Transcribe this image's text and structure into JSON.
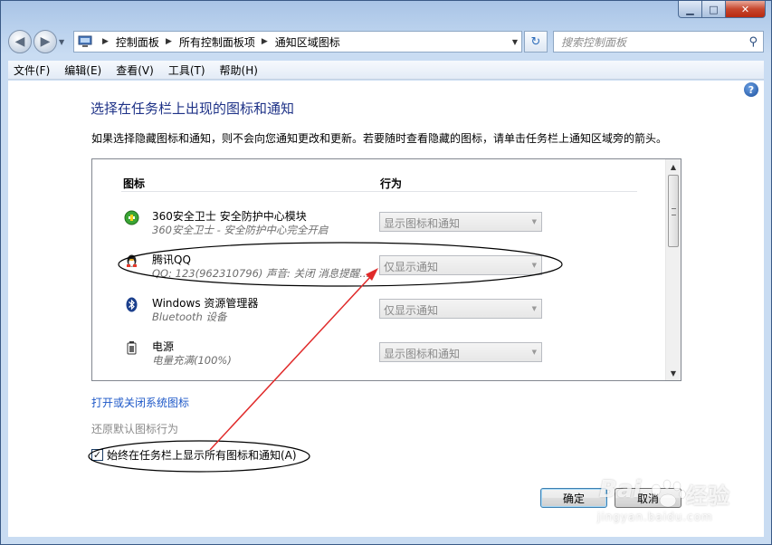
{
  "window": {
    "caption_buttons": {
      "minimize": "▁",
      "maximize": "□",
      "close": "✕"
    }
  },
  "nav": {
    "back_icon": "◀",
    "forward_icon": "▶",
    "breadcrumb": [
      "控制面板",
      "所有控制面板项",
      "通知区域图标"
    ],
    "search_placeholder": "搜索控制面板"
  },
  "menu": [
    "文件(F)",
    "编辑(E)",
    "查看(V)",
    "工具(T)",
    "帮助(H)"
  ],
  "page": {
    "title": "选择在任务栏上出现的图标和通知",
    "description": "如果选择隐藏图标和通知，则不会向您通知更改和更新。若要随时查看隐藏的图标，请单击任务栏上通知区域旁的箭头。",
    "col_icon": "图标",
    "col_behavior": "行为",
    "rows": [
      {
        "name": "360安全卫士 安全防护中心模块",
        "sub": "360安全卫士 - 安全防护中心完全开启",
        "behavior": "显示图标和通知",
        "icon": "shield-icon"
      },
      {
        "name": "腾讯QQ",
        "sub": "QQ: 123(962310796)  声音: 关闭  消息提醒...",
        "behavior": "仅显示通知",
        "icon": "qq-penguin-icon"
      },
      {
        "name": "Windows 资源管理器",
        "sub": "Bluetooth 设备",
        "behavior": "仅显示通知",
        "icon": "bluetooth-icon"
      },
      {
        "name": "电源",
        "sub": "电量充满(100%)",
        "behavior": "显示图标和通知",
        "icon": "power-icon"
      }
    ],
    "link_system_icons": "打开或关闭系统图标",
    "link_restore": "还原默认图标行为",
    "checkbox_label": "始终在任务栏上显示所有图标和通知(A)",
    "checkbox_checked": true,
    "ok": "确定",
    "cancel": "取消"
  },
  "watermark": {
    "brand": "Bai",
    "brand2": "经验",
    "site": "jingyan.baidu.com"
  }
}
